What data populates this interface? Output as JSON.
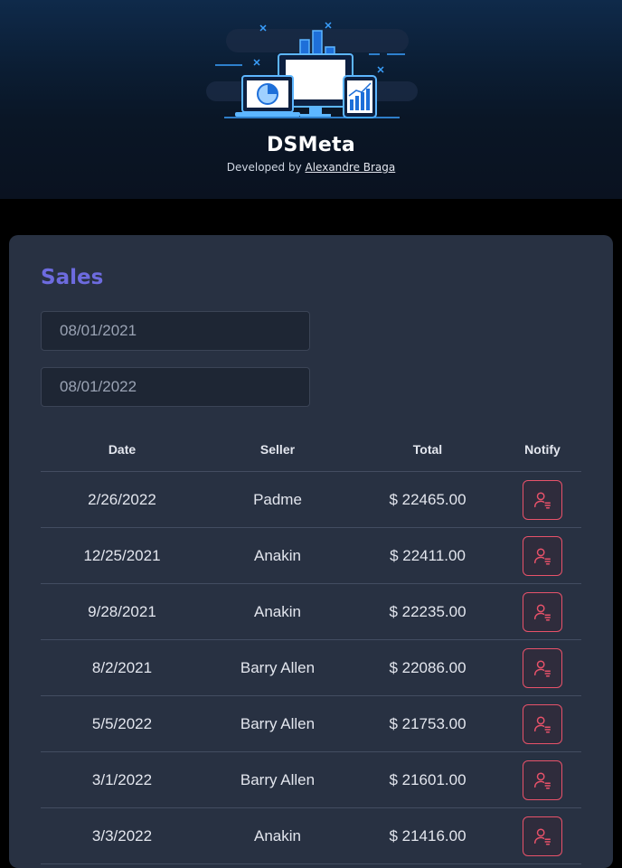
{
  "header": {
    "brand": "DSMeta",
    "credit_prefix": "Developed by ",
    "author": "Alexandre Braga",
    "logo_icon": "dashboard-devices-illustration"
  },
  "sales": {
    "title": "Sales",
    "min_date": "08/01/2021",
    "max_date": "08/01/2022",
    "columns": {
      "date": "Date",
      "seller": "Seller",
      "total": "Total",
      "notify": "Notify"
    },
    "rows": [
      {
        "date": "2/26/2022",
        "seller": "Padme",
        "total": "$ 22465.00"
      },
      {
        "date": "12/25/2021",
        "seller": "Anakin",
        "total": "$ 22411.00"
      },
      {
        "date": "9/28/2021",
        "seller": "Anakin",
        "total": "$ 22235.00"
      },
      {
        "date": "8/2/2021",
        "seller": "Barry Allen",
        "total": "$ 22086.00"
      },
      {
        "date": "5/5/2022",
        "seller": "Barry Allen",
        "total": "$ 21753.00"
      },
      {
        "date": "3/1/2022",
        "seller": "Barry Allen",
        "total": "$ 21601.00"
      },
      {
        "date": "3/3/2022",
        "seller": "Anakin",
        "total": "$ 21416.00"
      }
    ],
    "notify_icon": "user-notify-icon",
    "accent_color": "#6d6bdf",
    "notify_color": "#e8526a"
  }
}
